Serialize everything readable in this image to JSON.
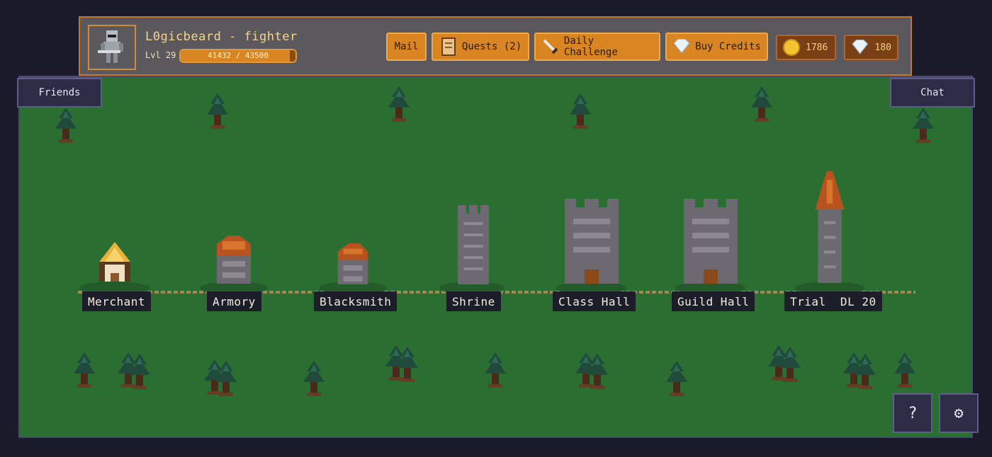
{
  "player": {
    "name": "L0gicbeard - fighter",
    "level_label": "Lvl 29",
    "xp_text": "41432 / 43500",
    "xp_fraction": 0.9525
  },
  "toolbar": {
    "mail_label": "Mail",
    "quests_label": "Quests (2)",
    "daily_label": "Daily Challenge",
    "credits_label": "Buy Credits"
  },
  "currency": {
    "gold": "1786",
    "gems": "180"
  },
  "side": {
    "friends_label": "Friends",
    "chat_label": "Chat"
  },
  "buildings": [
    {
      "label": "Merchant",
      "icon": "merchant-tent-icon"
    },
    {
      "label": "Armory",
      "icon": "armory-house-icon"
    },
    {
      "label": "Blacksmith",
      "icon": "blacksmith-house-icon"
    },
    {
      "label": "Shrine",
      "icon": "shrine-tower-icon"
    },
    {
      "label": "Class Hall",
      "icon": "class-hall-tower-icon"
    },
    {
      "label": "Guild Hall",
      "icon": "guild-hall-tower-icon"
    },
    {
      "label": "Trial  DL 20",
      "icon": "trial-spire-icon"
    }
  ],
  "corner": {
    "help_label": "?",
    "settings_icon": "gear-icon"
  },
  "colors": {
    "accent": "#d98521",
    "grass": "#2a6e31",
    "panel": "#5b585e"
  }
}
